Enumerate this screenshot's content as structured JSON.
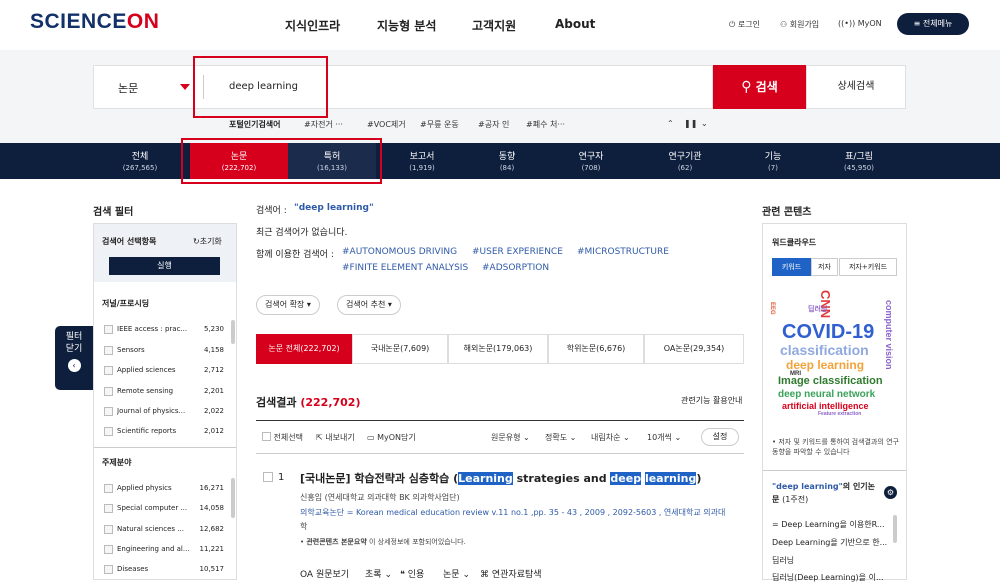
{
  "header": {
    "logo_main": "SCIENCE",
    "logo_on": "ON",
    "nav": [
      "지식인프라",
      "지능형 분석",
      "고객지원",
      "About"
    ],
    "login": "로그인",
    "signup": "회원가입",
    "myon": "MyON",
    "all_menu": "≡ 전체메뉴"
  },
  "search": {
    "category": "논문",
    "query": "deep learning",
    "button": "검색",
    "advanced": "상세검색",
    "popular_label": "포털인기검색어",
    "popular_tags": [
      "#자전거 ···",
      "#VOC제거",
      "#무릎 운동",
      "#공자 인",
      "#폐수 처···"
    ],
    "accent": "#d6001c"
  },
  "tabs": [
    {
      "label": "전체",
      "count": "(267,565)"
    },
    {
      "label": "논문",
      "count": "(222,702)"
    },
    {
      "label": "특허",
      "count": "(16,133)"
    },
    {
      "label": "보고서",
      "count": "(1,919)"
    },
    {
      "label": "동향",
      "count": "(84)"
    },
    {
      "label": "연구자",
      "count": "(708)"
    },
    {
      "label": "연구기관",
      "count": "(62)"
    },
    {
      "label": "기능",
      "count": "(7)"
    },
    {
      "label": "표/그림",
      "count": "(45,950)"
    }
  ],
  "filter": {
    "title": "검색 필터",
    "head": "검색어 선택항목",
    "reset": "초기화",
    "apply": "실행",
    "close": [
      "필터",
      "닫기"
    ],
    "groups": [
      {
        "name": "저널/프로시딩",
        "items": [
          {
            "label": "IEEE access : prac...",
            "count": "5,230"
          },
          {
            "label": "Sensors",
            "count": "4,158"
          },
          {
            "label": "Applied sciences",
            "count": "2,712"
          },
          {
            "label": "Remote sensing",
            "count": "2,201"
          },
          {
            "label": "Journal of physics...",
            "count": "2,022"
          },
          {
            "label": "Scientific reports",
            "count": "2,012"
          }
        ]
      },
      {
        "name": "주제분야",
        "items": [
          {
            "label": "Applied physics",
            "count": "16,271"
          },
          {
            "label": "Special computer ...",
            "count": "14,058"
          },
          {
            "label": "Natural sciences ...",
            "count": "12,682"
          },
          {
            "label": "Engineering and al...",
            "count": "11,221"
          },
          {
            "label": "Diseases",
            "count": "10,517"
          }
        ]
      }
    ]
  },
  "main": {
    "query_label": "검색어 :",
    "query_value": "\"deep learning\"",
    "recent": "최근 검색어가 없습니다.",
    "related_label": "함께 이용한 검색어 :",
    "related_line1": [
      "#AUTONOMOUS DRIVING",
      "#USER EXPERIENCE",
      "#MICROSTRUCTURE"
    ],
    "related_line2": [
      "#FINITE ELEMENT ANALYSIS",
      "#ADSORPTION"
    ],
    "expand": "검색어 확장",
    "recommend": "검색어 추천",
    "doc_tabs": [
      "논문 전체(222,702)",
      "국내논문(7,609)",
      "해외논문(179,063)",
      "학위논문(6,676)",
      "OA논문(29,354)"
    ],
    "result_label": "검색결과",
    "result_count": "(222,702)",
    "guide": "관련기능 활용안내",
    "toolbar": [
      "전체선택",
      "내보내기",
      "MyON담기",
      "원문유형",
      "정확도",
      "내림차순",
      "10개씩"
    ],
    "settings": "설정",
    "result": {
      "num": "1",
      "title_prefix": "[국내논문] 학습전략과 심층학습 (",
      "title_w1": "Learning",
      "title_mid1": " strategies and ",
      "title_w2": "deep",
      "title_mid2": " ",
      "title_w3": "learning",
      "title_end": ")",
      "authors": "신홍임 (연세대학교 의과대학 BK 의과학사업단)",
      "source1": "의학교육논단 = Korean medical education review v.11 no.1 ,pp. 35 - 43 , 2009 , 2092-5603 , 연세대학교 의과대",
      "source2": "학",
      "note_bold": "관련콘텐츠 본문요약",
      "note_rest": "이 상세정보에 포함되어있습니다.",
      "actions": [
        "OA 원문보기",
        "초록",
        "인용",
        "논문",
        "연관자료탐색"
      ]
    }
  },
  "right": {
    "title": "관련 콘텐츠",
    "wordcloud_title": "워드클라우드",
    "buttons": [
      "키워드",
      "저자",
      "저자+키워드"
    ],
    "words": [
      "COVID-19",
      "classification",
      "deep learning",
      "Image classification",
      "deep neural network",
      "artificial intelligence",
      "CNN",
      "computer vision",
      "MRI",
      "EEG",
      "딥러닝",
      "Feature extraction"
    ],
    "caption": "• 저자 및 키워드를 통하여 검색결과의 연구동향을 파악할 수 있습니다",
    "related_header_q": "\"deep learning\"",
    "related_header_rest": "의 인기논문",
    "related_header_period": "(1주전)",
    "related_items": [
      "= Deep Learning을 이용한R...",
      "Deep Learning을 기반으로 한...",
      "딥러닝",
      "딥러닝(Deep Learning)을 이..."
    ]
  }
}
